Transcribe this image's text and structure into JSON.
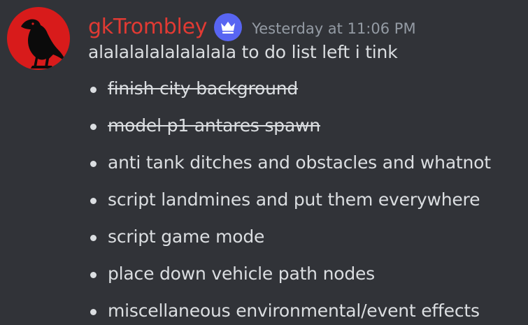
{
  "message": {
    "author": {
      "username": "gkTrombley",
      "avatar_icon": "raven-icon",
      "avatar_color": "#d81b1b",
      "name_color": "#e23a33",
      "badge_icon": "crown-icon",
      "badge_color": "#5865f2"
    },
    "timestamp": "Yesterday at 11:06 PM",
    "text": "alalalalalalalalala to do list left i tink",
    "list": [
      {
        "text": "finish city background",
        "struck": true
      },
      {
        "text": "model p1 antares spawn",
        "struck": true
      },
      {
        "text": "anti tank ditches and obstacles and whatnot",
        "struck": false
      },
      {
        "text": "script landmines and put them everywhere",
        "struck": false
      },
      {
        "text": "script game mode",
        "struck": false
      },
      {
        "text": "place down vehicle path nodes",
        "struck": false
      },
      {
        "text": "miscellaneous environmental/event effects",
        "struck": false
      }
    ]
  }
}
